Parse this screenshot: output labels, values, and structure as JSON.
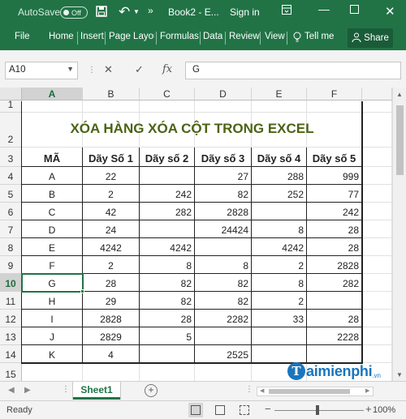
{
  "titlebar": {
    "autosave_label": "AutoSave",
    "autosave_state": "Off",
    "doc_title": "Book2 - E...",
    "signin": "Sign in"
  },
  "ribbon": {
    "tabs": [
      "File",
      "Home",
      "Insert",
      "Page Layout",
      "Formulas",
      "Data",
      "Review",
      "View"
    ],
    "tell_me": "Tell me",
    "share": "Share"
  },
  "formula_bar": {
    "name_box": "A10",
    "fx": "fx",
    "content": "G"
  },
  "grid": {
    "columns": [
      "A",
      "B",
      "C",
      "D",
      "E",
      "F"
    ],
    "rows": [
      "1",
      "2",
      "3",
      "4",
      "5",
      "6",
      "7",
      "8",
      "9",
      "10",
      "11",
      "12",
      "13",
      "14",
      "15"
    ],
    "active_row": "10",
    "title": "XÓA HÀNG XÓA CỘT TRONG EXCEL",
    "headers": [
      "MÃ",
      "Dãy Số 1",
      "Dãy số 2",
      "Dãy số 3",
      "Dãy số 4",
      "Dãy số 5"
    ],
    "data": [
      [
        "A",
        "22",
        "",
        "27",
        "288",
        "999"
      ],
      [
        "B",
        "2",
        "242",
        "82",
        "252",
        "77"
      ],
      [
        "C",
        "42",
        "282",
        "2828",
        "",
        "242"
      ],
      [
        "D",
        "24",
        "",
        "24424",
        "8",
        "28"
      ],
      [
        "E",
        "4242",
        "4242",
        "",
        "4242",
        "28"
      ],
      [
        "F",
        "2",
        "8",
        "8",
        "2",
        "2828"
      ],
      [
        "G",
        "28",
        "82",
        "82",
        "8",
        "282"
      ],
      [
        "H",
        "29",
        "82",
        "82",
        "2",
        ""
      ],
      [
        "I",
        "2828",
        "28",
        "2282",
        "33",
        "28"
      ],
      [
        "J",
        "2829",
        "5",
        "",
        "",
        "2228"
      ],
      [
        "K",
        "4",
        "",
        "2525",
        "",
        ""
      ]
    ]
  },
  "sheets": {
    "active": "Sheet1",
    "add_label": "+"
  },
  "status": {
    "text": "Ready",
    "zoom_out": "−",
    "zoom_in": "+",
    "zoom": "100%"
  },
  "watermark": {
    "logo_letter": "T",
    "text": "aimienphi",
    "suffix": ".vn"
  },
  "colors": {
    "excel_green": "#217346",
    "title_text": "#4b6314",
    "watermark_blue": "#1b75bc"
  }
}
